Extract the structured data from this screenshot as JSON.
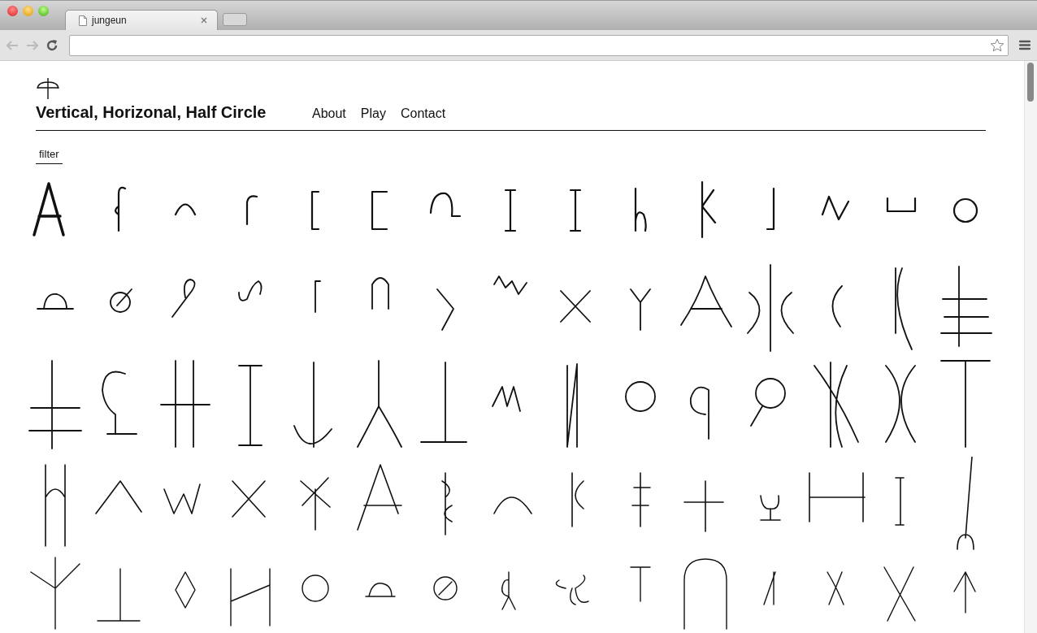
{
  "browser": {
    "tabs": [
      {
        "title": "jungeun",
        "selected": true
      }
    ]
  },
  "site": {
    "title": "Vertical, Horizonal, Half Circle",
    "nav": [
      "About",
      "Play",
      "Contact"
    ],
    "filter": "filter"
  }
}
